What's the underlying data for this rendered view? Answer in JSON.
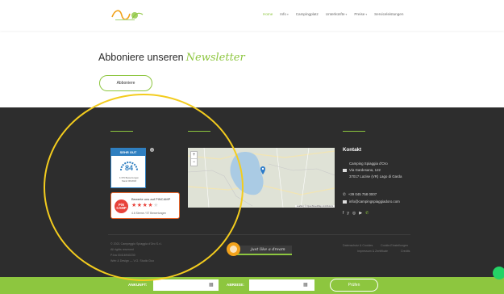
{
  "nav": {
    "items": [
      {
        "label": "Home",
        "active": true,
        "caret": false
      },
      {
        "label": "Info",
        "active": false,
        "caret": true
      },
      {
        "label": "Campingplatz",
        "active": false,
        "caret": false
      },
      {
        "label": "Unterkünfte",
        "active": false,
        "caret": true
      },
      {
        "label": "Preise",
        "active": false,
        "caret": true
      },
      {
        "label": "Serviceleistungen",
        "active": false,
        "caret": false
      }
    ]
  },
  "newsletter": {
    "title_plain": "Abboniere unseren",
    "title_script": "Newsletter",
    "button_label": "Abboniere"
  },
  "badge": {
    "header": "SEHR GUT",
    "score": "84",
    "sub": "4.379 Bewertungen",
    "sub2": "Stand 06/2018",
    "info": "i"
  },
  "pincamp": {
    "logo": "PiN CAMP",
    "title": "Bewerte uns auf PINCAMP",
    "rating_stars": 4,
    "max_stars": 5,
    "sub": "4.6 Sterne / 57 Bewertungen"
  },
  "map": {
    "zoom_in": "+",
    "zoom_out": "−",
    "attribution": "Leaflet | © OpenStreetMap contributors"
  },
  "contact": {
    "title": "Kontakt",
    "name": "Camping Spiaggia d'Oro",
    "street": "Via Gardesana, 122",
    "city": "37017 Lazise (VR) Lago di Garda",
    "phone": "+39 045 758 0007",
    "email": "info@campingspiaggiadoro.com",
    "social": [
      "f",
      "y",
      "◎",
      "▶",
      "✆"
    ]
  },
  "copyright": {
    "line1": "© 2021 Campeggio Spiaggia d'Oro S.r.l.",
    "line2": "All rights reserved",
    "line3": "P.Iva 00416940230",
    "line4": "Web & Design — V.G. Studio Duo"
  },
  "footer_links": {
    "col1_a": "Datenschutz & Cookies",
    "col1_b": "Cookie-Einstellungen",
    "col2_a": "Impressum & Zertifikate",
    "col2_b": "Credits"
  },
  "brand": {
    "slogan": "just like a dream"
  },
  "booking": {
    "arrival_label": "ANKUNFT:",
    "departure_label": "ABREISE:",
    "check_label": "Prüfen",
    "calendar_glyph": "▦"
  },
  "colors": {
    "accent": "#8dc63f",
    "footer_bg": "#2d2d2d",
    "badge_blue": "#2f7fc0",
    "pincamp_red": "#e8423a",
    "annotation": "#f3cc1e"
  }
}
